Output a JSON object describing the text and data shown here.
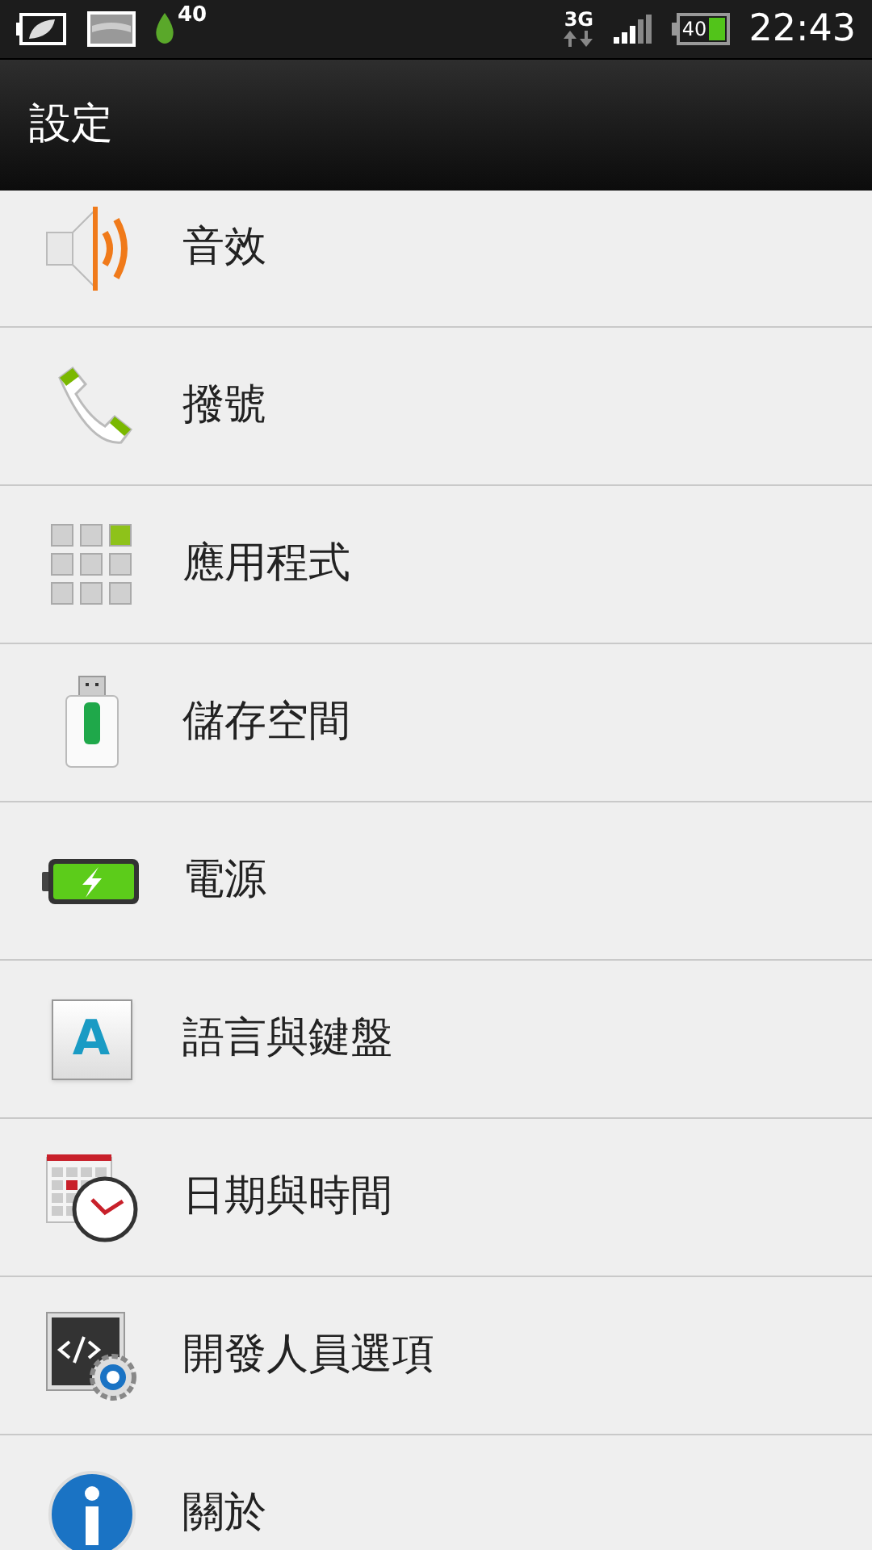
{
  "status_bar": {
    "leaf_count": "40",
    "network": "3G",
    "battery": "40",
    "time": "22:43"
  },
  "title": "設定",
  "items": [
    {
      "kind": "sound",
      "label": "音效"
    },
    {
      "kind": "phone",
      "label": "撥號"
    },
    {
      "kind": "apps",
      "label": "應用程式"
    },
    {
      "kind": "storage",
      "label": "儲存空間"
    },
    {
      "kind": "power",
      "label": "電源"
    },
    {
      "kind": "language",
      "label": "語言與鍵盤",
      "glyph": "A"
    },
    {
      "kind": "datetime",
      "label": "日期與時間"
    },
    {
      "kind": "developer",
      "label": "開發人員選項"
    },
    {
      "kind": "about",
      "label": "關於"
    }
  ]
}
